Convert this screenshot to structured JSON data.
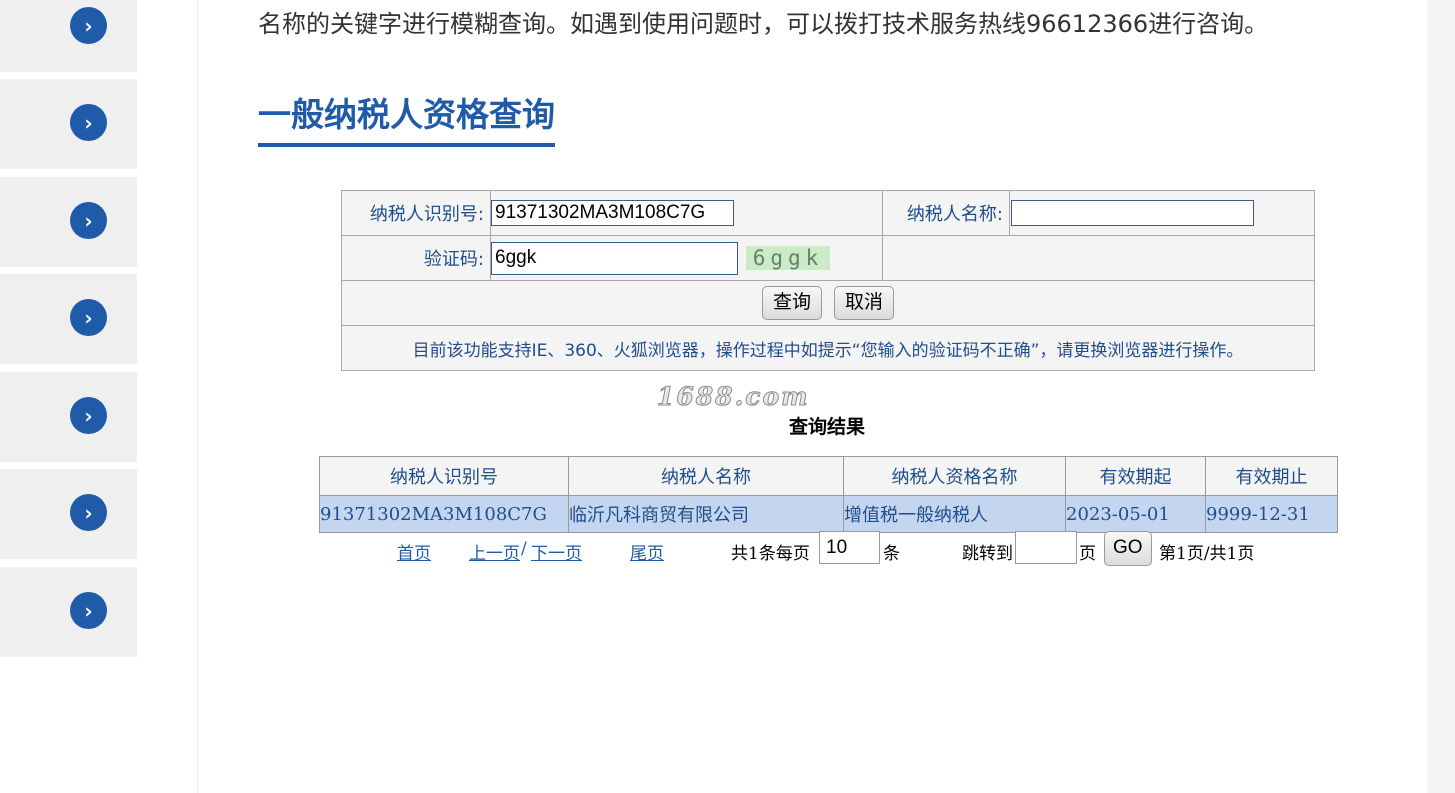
{
  "intro_text": "名称的关键字进行模糊查询。如遇到使用问题时，可以拨打技术服务热线96612366进行咨询。",
  "section_title": "一般纳税人资格查询",
  "sidebar": {
    "items": [
      {
        "icon": "chevron-right-icon",
        "symbol": "›"
      },
      {
        "icon": "chevron-right-icon",
        "symbol": "›"
      },
      {
        "icon": "chevron-right-icon",
        "symbol": "›"
      },
      {
        "icon": "chevron-right-icon",
        "symbol": "›"
      },
      {
        "icon": "chevron-right-icon",
        "symbol": "›"
      },
      {
        "icon": "chevron-right-icon",
        "symbol": "›"
      },
      {
        "icon": "chevron-right-icon",
        "symbol": "›"
      }
    ]
  },
  "form": {
    "taxpayer_id_label": "纳税人识别号:",
    "taxpayer_id_value": "91371302MA3M108C7G",
    "taxpayer_name_label": "纳税人名称:",
    "taxpayer_name_value": "",
    "captcha_label": "验证码:",
    "captcha_value": "6ggk",
    "captcha_image_text": "6ggk",
    "query_button": "查询",
    "cancel_button": "取消",
    "notice": "目前该功能支持IE、360、火狐浏览器，操作过程中如提示“您输入的验证码不正确”，请更换浏览器进行操作。"
  },
  "watermark": "1688.com",
  "results": {
    "title": "查询结果",
    "columns": [
      "纳税人识别号",
      "纳税人名称",
      "纳税人资格名称",
      "有效期起",
      "有效期止"
    ],
    "rows": [
      [
        "91371302MA3M108C7G",
        "临沂凡科商贸有限公司",
        "增值税一般纳税人",
        "2023-05-01",
        "9999-12-31"
      ]
    ]
  },
  "pager": {
    "first": "首页",
    "prev": "上一页",
    "sep": "/",
    "next": "下一页",
    "last": "尾页",
    "total_prefix": "共1条每页",
    "page_size": "10",
    "page_size_suffix": "条",
    "jump_label": "跳转到",
    "jump_value": "",
    "page_unit": "页",
    "go_button": "GO",
    "page_info": "第1页/共1页"
  },
  "colors": {
    "brand_blue": "#1f5ba8",
    "row_highlight": "#c4d6ef",
    "label_text": "#1f4e8c"
  }
}
